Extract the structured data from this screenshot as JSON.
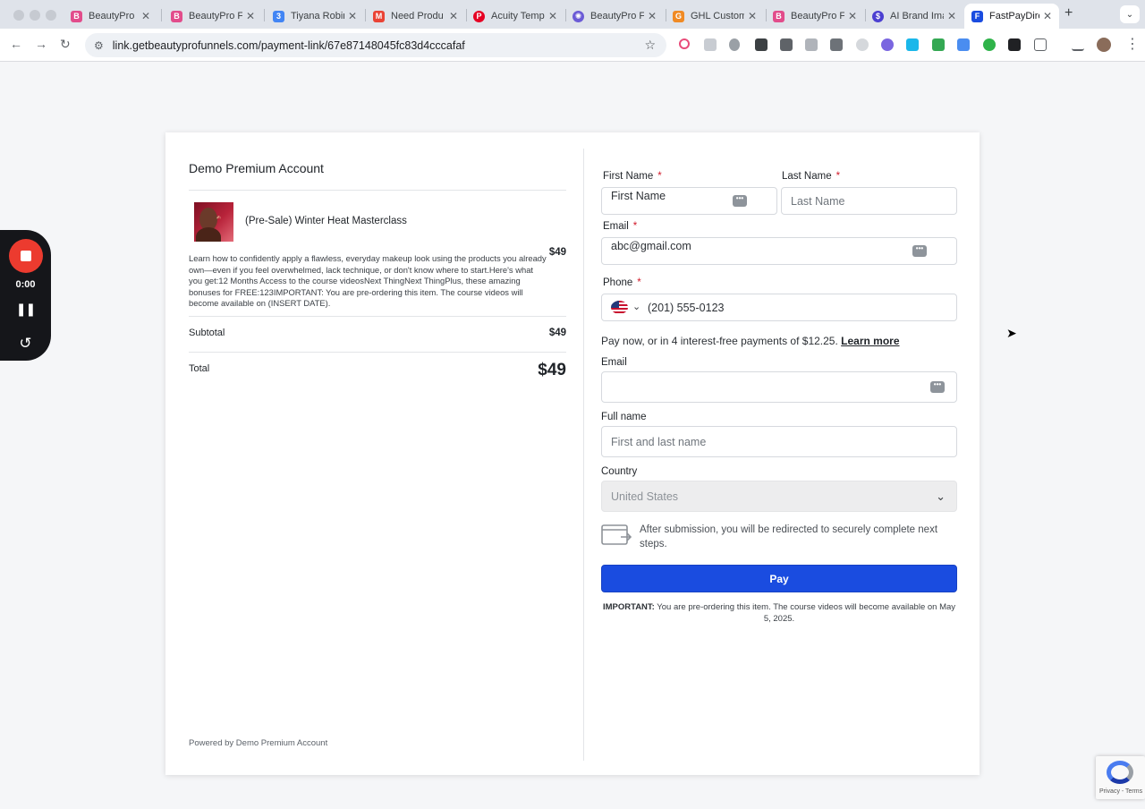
{
  "browser": {
    "tabs": [
      {
        "title": "BeautyPro F",
        "icon": "beautypro-favicon",
        "color": "#e24c8b"
      },
      {
        "title": "BeautyPro F",
        "icon": "beautypro-favicon",
        "color": "#e24c8b"
      },
      {
        "title": "Tiyana Robin",
        "icon": "calendar-favicon",
        "color": "#4285f4"
      },
      {
        "title": "Need Produ",
        "icon": "gmail-favicon",
        "color": "#ea4335"
      },
      {
        "title": "Acuity Temp",
        "icon": "pinterest-favicon",
        "color": "#e60023"
      },
      {
        "title": "BeautyPro F",
        "icon": "settings-favicon",
        "color": "#6b5bd6"
      },
      {
        "title": "GHL Custom",
        "icon": "ghl-favicon",
        "color": "#f08a24"
      },
      {
        "title": "BeautyPro F",
        "icon": "beautypro-favicon",
        "color": "#e24c8b"
      },
      {
        "title": "AI Brand Ima",
        "icon": "ai-brand-favicon",
        "color": "#4b3fd1"
      },
      {
        "title": "FastPayDire",
        "icon": "fastpay-favicon",
        "color": "#1a4ce0"
      }
    ],
    "url": "link.getbeautyprofunnels.com/payment-link/67e87148045fc83d4cccafaf"
  },
  "recorder": {
    "time": "0:00"
  },
  "order": {
    "account_title": "Demo Premium Account",
    "product_name": "(Pre-Sale) Winter Heat Masterclass",
    "product_price": "$49",
    "product_description": "Learn how to confidently apply a flawless, everyday makeup look using the products you already own—even if you feel overwhelmed, lack technique, or don't know where to start.Here's what you get:12 Months Access to the course videosNext ThingNext ThingPlus, these amazing bonuses for FREE:123IMPORTANT: You are pre-ordering this item. The course videos will become available on (INSERT DATE).",
    "subtotal_label": "Subtotal",
    "subtotal_value": "$49",
    "total_label": "Total",
    "total_value": "$49",
    "powered_by": "Powered by Demo Premium Account"
  },
  "form": {
    "first_name": {
      "label": "First Name",
      "value": "First Name"
    },
    "last_name": {
      "label": "Last Name",
      "placeholder": "Last Name"
    },
    "email": {
      "label": "Email",
      "value": "abc@gmail.com"
    },
    "phone": {
      "label": "Phone",
      "value": "(201) 555-0123"
    },
    "required_mark": "*",
    "installments_text": "Pay now, or in 4 interest-free payments of $12.25.",
    "learn_more": "Learn more",
    "pay_email": {
      "label": "Email",
      "value": ""
    },
    "full_name": {
      "label": "Full name",
      "placeholder": "First and last name"
    },
    "country": {
      "label": "Country",
      "value": "United States"
    },
    "redirect_text": "After submission, you will be redirected to securely complete next steps.",
    "pay_button": "Pay",
    "important_label": "IMPORTANT:",
    "important_text": "You are pre-ordering this item. The course videos will become available on May 5, 2025."
  },
  "recaptcha": {
    "terms": "Privacy - Terms"
  },
  "colors": {
    "accent": "#1a4ce0",
    "required": "#d11a2a",
    "recorder_red": "#ec3b2f"
  }
}
